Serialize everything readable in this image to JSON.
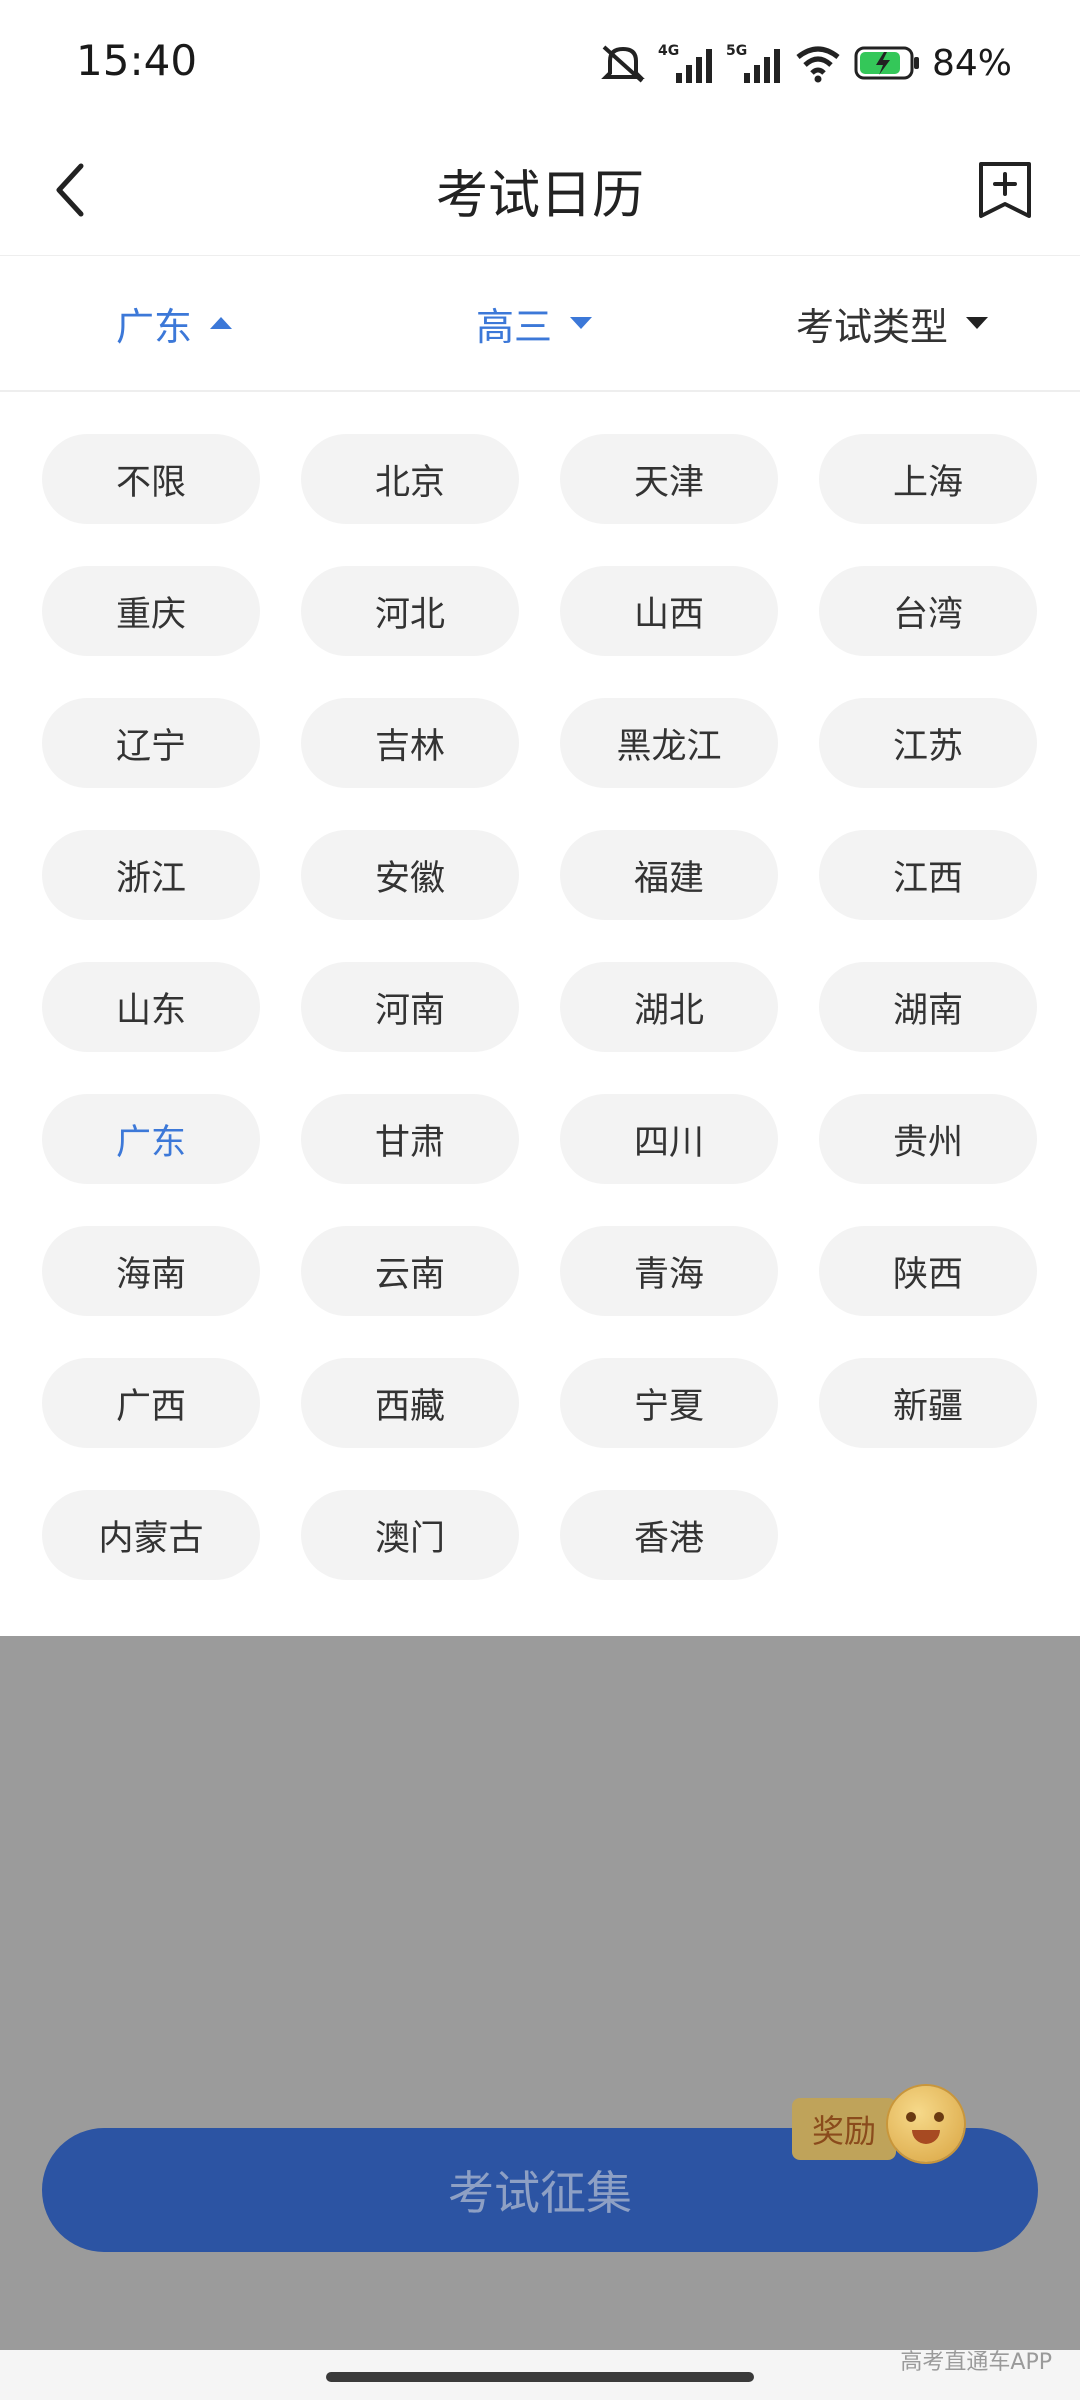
{
  "status_bar": {
    "time": "15:40",
    "battery": "84%"
  },
  "header": {
    "title": "考试日历"
  },
  "filters": {
    "region": "广东",
    "grade": "高三",
    "exam_type": "考试类型"
  },
  "regions": [
    {
      "label": "不限"
    },
    {
      "label": "北京"
    },
    {
      "label": "天津"
    },
    {
      "label": "上海"
    },
    {
      "label": "重庆"
    },
    {
      "label": "河北"
    },
    {
      "label": "山西"
    },
    {
      "label": "台湾"
    },
    {
      "label": "辽宁"
    },
    {
      "label": "吉林"
    },
    {
      "label": "黑龙江"
    },
    {
      "label": "江苏"
    },
    {
      "label": "浙江"
    },
    {
      "label": "安徽"
    },
    {
      "label": "福建"
    },
    {
      "label": "江西"
    },
    {
      "label": "山东"
    },
    {
      "label": "河南"
    },
    {
      "label": "湖北"
    },
    {
      "label": "湖南"
    },
    {
      "label": "广东",
      "selected": true
    },
    {
      "label": "甘肃"
    },
    {
      "label": "四川"
    },
    {
      "label": "贵州"
    },
    {
      "label": "海南"
    },
    {
      "label": "云南"
    },
    {
      "label": "青海"
    },
    {
      "label": "陕西"
    },
    {
      "label": "广西"
    },
    {
      "label": "西藏"
    },
    {
      "label": "宁夏"
    },
    {
      "label": "新疆"
    },
    {
      "label": "内蒙古"
    },
    {
      "label": "澳门"
    },
    {
      "label": "香港"
    }
  ],
  "cta": {
    "label": "考试征集",
    "badge": "奖励"
  },
  "watermark": "高考直通车APP",
  "colors": {
    "accent": "#3c78d8",
    "cta_bg": "#2c54a3",
    "chip_bg": "#f3f3f3"
  }
}
